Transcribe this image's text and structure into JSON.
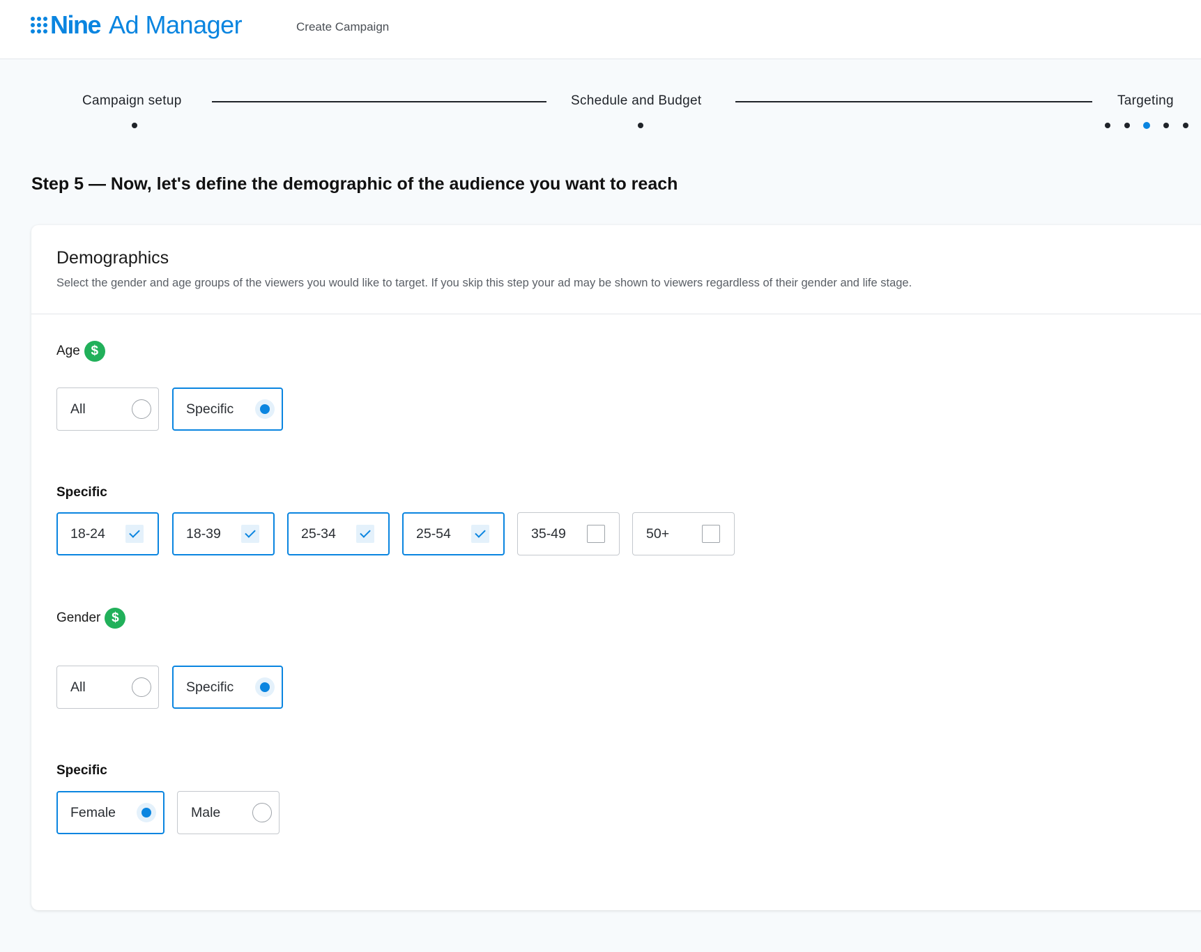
{
  "header": {
    "logo_nine": "Nine",
    "logo_product": "Ad Manager",
    "crumb": "Create Campaign"
  },
  "stepper": {
    "steps": [
      {
        "label": "Campaign setup"
      },
      {
        "label": "Schedule and Budget"
      },
      {
        "label": "Targeting",
        "sub_steps": 5,
        "active_sub_step": 3
      }
    ]
  },
  "page": {
    "title": "Step 5 — Now, let's define the demographic of the audience you want to reach"
  },
  "demographics": {
    "title": "Demographics",
    "description": "Select the gender and age groups of the viewers you would like to target. If you skip this step your ad may be shown to viewers regardless of their gender and life stage.",
    "age": {
      "label": "Age",
      "badge": "$",
      "mode_options": [
        {
          "label": "All",
          "selected": false
        },
        {
          "label": "Specific",
          "selected": true
        }
      ],
      "specific_label": "Specific",
      "groups": [
        {
          "label": "18-24",
          "checked": true
        },
        {
          "label": "18-39",
          "checked": true
        },
        {
          "label": "25-34",
          "checked": true
        },
        {
          "label": "25-54",
          "checked": true
        },
        {
          "label": "35-49",
          "checked": false
        },
        {
          "label": "50+",
          "checked": false
        }
      ]
    },
    "gender": {
      "label": "Gender",
      "badge": "$",
      "mode_options": [
        {
          "label": "All",
          "selected": false
        },
        {
          "label": "Specific",
          "selected": true
        }
      ],
      "specific_label": "Specific",
      "options": [
        {
          "label": "Female",
          "selected": true
        },
        {
          "label": "Male",
          "selected": false
        }
      ]
    }
  },
  "colors": {
    "accent": "#0a85e0",
    "badge_green": "#21b05a"
  }
}
